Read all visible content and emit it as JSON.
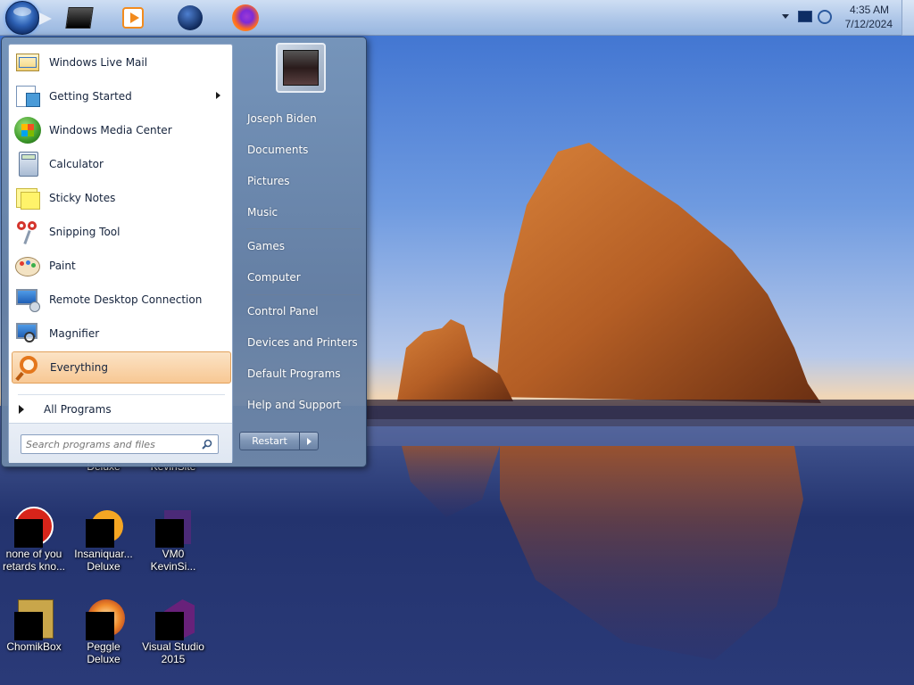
{
  "taskbar": {
    "pinned": [
      {
        "icon": "black-app-icon"
      },
      {
        "icon": "media-player-icon"
      },
      {
        "icon": "globe-icon"
      },
      {
        "icon": "firefox-icon"
      }
    ],
    "clock": {
      "time": "4:35 AM",
      "date": "7/12/2024"
    }
  },
  "start_menu": {
    "programs": [
      {
        "label": "Windows Live Mail",
        "icon": "mail-icon"
      },
      {
        "label": "Getting Started",
        "icon": "getting-started-icon",
        "submenu": true
      },
      {
        "label": "Windows Media Center",
        "icon": "media-center-icon"
      },
      {
        "label": "Calculator",
        "icon": "calculator-icon"
      },
      {
        "label": "Sticky Notes",
        "icon": "sticky-notes-icon"
      },
      {
        "label": "Snipping Tool",
        "icon": "scissors-icon"
      },
      {
        "label": "Paint",
        "icon": "paint-palette-icon"
      },
      {
        "label": "Remote Desktop Connection",
        "icon": "remote-desktop-icon"
      },
      {
        "label": "Magnifier",
        "icon": "magnifier-icon"
      },
      {
        "label": "Everything",
        "icon": "everything-search-icon",
        "highlighted": true
      }
    ],
    "all_programs": "All Programs",
    "search": {
      "placeholder": "Search programs and files"
    },
    "right": {
      "user": "Joseph Biden",
      "documents": "Documents",
      "pictures": "Pictures",
      "music": "Music",
      "games": "Games",
      "computer": "Computer",
      "control_panel": "Control Panel",
      "devices": "Devices and Printers",
      "defaults": "Default Programs",
      "help": "Help and Support"
    },
    "restart": "Restart"
  },
  "desktop": {
    "row1": [
      {
        "caption": "Deluxe"
      },
      {
        "caption": "KevinSite"
      }
    ],
    "row2": [
      {
        "caption1": "none of you",
        "caption2": "retards kno..."
      },
      {
        "caption1": "Insaniquar...",
        "caption2": "Deluxe"
      },
      {
        "caption1": "VM0",
        "caption2": "KevinSi..."
      }
    ],
    "row3": [
      {
        "caption1": "ChomikBox",
        "caption2": ""
      },
      {
        "caption1": "Peggle Deluxe",
        "caption2": ""
      },
      {
        "caption1": "Visual Studio",
        "caption2": "2015"
      }
    ]
  },
  "colors": {
    "accent": "#2c5fb2",
    "highlight": "#f8c894"
  }
}
